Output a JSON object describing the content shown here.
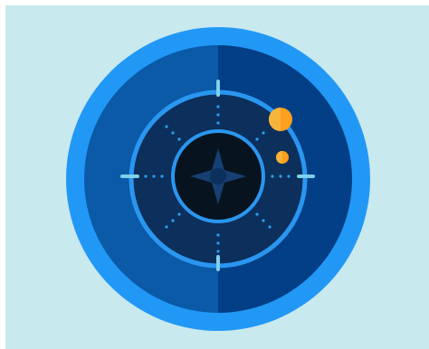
{
  "illustration": {
    "subject": "radar-compass",
    "colors": {
      "background": "#c8e9ee",
      "outer_ring": "#2298f6",
      "dial_left": "#0a5aa8",
      "dial_right": "#033f86",
      "scope_fill": "#0c2f5c",
      "scope_ring": "#2a96f0",
      "core": "#07141f",
      "compass_star": "#163f72",
      "ticks": "#7fd0ea",
      "dots": "#2a9ff0",
      "blip": "#ff9f1c",
      "blip_shade": "#f6b43b"
    },
    "icons": [
      "compass-star-icon",
      "radar-blip-icon"
    ]
  }
}
